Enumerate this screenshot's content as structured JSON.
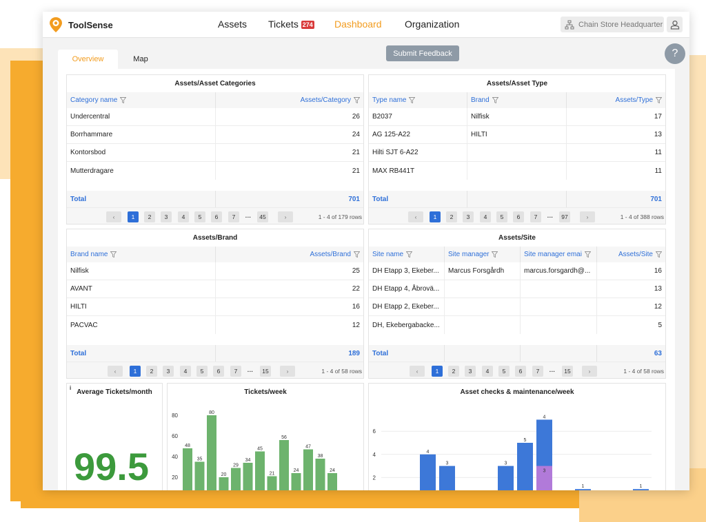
{
  "brand": {
    "name": "ToolSense",
    "accent": "#f29c1f"
  },
  "nav": {
    "assets": "Assets",
    "tickets": "Tickets",
    "tickets_badge": "274",
    "dashboard": "Dashboard",
    "organization": "Organization",
    "org_selector": "Chain Store Headquarter"
  },
  "tabs": {
    "overview": "Overview",
    "map": "Map"
  },
  "submit_feedback": "Submit Feedback",
  "help": "?",
  "panels": {
    "categories": {
      "title": "Assets/Asset Categories",
      "col1": "Category name",
      "col2": "Assets/Category",
      "rows": [
        {
          "name": "Undercentral",
          "value": "26"
        },
        {
          "name": "Borrhammare",
          "value": "24"
        },
        {
          "name": "Kontorsbod",
          "value": "21"
        },
        {
          "name": "Mutterdragare",
          "value": "21"
        }
      ],
      "total_label": "Total",
      "total": "701",
      "pages": [
        "1",
        "2",
        "3",
        "4",
        "5",
        "6",
        "7",
        "···",
        "45"
      ],
      "rows_info": "1 - 4 of 179 rows"
    },
    "types": {
      "title": "Assets/Asset Type",
      "col1": "Type name",
      "col2": "Brand",
      "col3": "Assets/Type",
      "rows": [
        {
          "name": "B2037",
          "brand": "Nilfisk",
          "value": "17"
        },
        {
          "name": "AG 125-A22",
          "brand": "HILTI",
          "value": "13"
        },
        {
          "name": "Hilti SJT 6-A22",
          "brand": "",
          "value": "11"
        },
        {
          "name": "MAX RB441T",
          "brand": "",
          "value": "11"
        }
      ],
      "total_label": "Total",
      "total": "701",
      "pages": [
        "1",
        "2",
        "3",
        "4",
        "5",
        "6",
        "7",
        "···",
        "97"
      ],
      "rows_info": "1 - 4 of 388 rows"
    },
    "brand": {
      "title": "Assets/Brand",
      "col1": "Brand name",
      "col2": "Assets/Brand",
      "rows": [
        {
          "name": "Nilfisk",
          "value": "25"
        },
        {
          "name": "AVANT",
          "value": "22"
        },
        {
          "name": "HILTI",
          "value": "16"
        },
        {
          "name": "PACVAC",
          "value": "12"
        }
      ],
      "total_label": "Total",
      "total": "189",
      "pages": [
        "1",
        "2",
        "3",
        "4",
        "5",
        "6",
        "7",
        "···",
        "15"
      ],
      "rows_info": "1 - 4 of 58 rows"
    },
    "site": {
      "title": "Assets/Site",
      "col1": "Site name",
      "col2": "Site manager",
      "col3": "Site manager emai",
      "col4": "Assets/Site",
      "rows": [
        {
          "name": "DH Etapp 3, Ekeber...",
          "manager": "Marcus Forsgårdh",
          "email": "marcus.forsgardh@...",
          "value": "16"
        },
        {
          "name": "DH Etapp 4, Åbrovä...",
          "manager": "",
          "email": "",
          "value": "13"
        },
        {
          "name": "DH Etapp 2, Ekeber...",
          "manager": "",
          "email": "",
          "value": "12"
        },
        {
          "name": "DH, Ekebergabacke...",
          "manager": "",
          "email": "",
          "value": "5"
        }
      ],
      "total_label": "Total",
      "total": "63",
      "pages": [
        "1",
        "2",
        "3",
        "4",
        "5",
        "6",
        "7",
        "···",
        "15"
      ],
      "rows_info": "1 - 4 of 58 rows"
    },
    "avg": {
      "info": "i",
      "title": "Average Tickets/month",
      "value": "99.5"
    }
  },
  "chart_data": [
    {
      "type": "bar",
      "title": "Tickets/week",
      "color": "#6db36d",
      "yticks": [
        20,
        40,
        60,
        80
      ],
      "values": [
        48,
        35,
        80,
        20,
        29,
        34,
        45,
        21,
        56,
        24,
        47,
        38,
        24
      ],
      "labels": [
        "48",
        "35",
        "80",
        "20",
        "29",
        "34",
        "45",
        "21",
        "56",
        "24",
        "47",
        "38",
        "24"
      ]
    },
    {
      "type": "bar",
      "title": "Asset checks & maintenance/week",
      "colors": [
        "#3d78d8",
        "#b17ad9"
      ],
      "yticks": [
        2,
        4,
        6
      ],
      "series": [
        {
          "values": [
            4,
            3,
            3,
            5,
            7,
            1,
            1
          ]
        },
        {
          "values": [
            0,
            0,
            0,
            0,
            3,
            0,
            0
          ]
        }
      ],
      "labels": [
        "4",
        "3",
        "3",
        "5",
        "4",
        "1",
        "1"
      ],
      "stack_label": "3"
    }
  ]
}
